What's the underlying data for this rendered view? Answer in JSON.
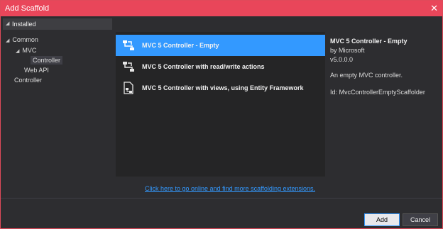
{
  "window": {
    "title": "Add Scaffold",
    "close_icon": "close-icon"
  },
  "tree": {
    "header": "Installed",
    "nodes": [
      {
        "label": "Common",
        "level": 0,
        "expanded": true
      },
      {
        "label": "MVC",
        "level": 1,
        "expanded": true
      },
      {
        "label": "Controller",
        "level": 2,
        "selected": true
      },
      {
        "label": "Web API",
        "level": 1
      },
      {
        "label": "Controller",
        "level": 0
      }
    ]
  },
  "scaffolds": [
    {
      "label": "MVC 5 Controller - Empty",
      "icon": "controller-icon",
      "selected": true
    },
    {
      "label": "MVC 5 Controller with read/write actions",
      "icon": "controller-icon"
    },
    {
      "label": "MVC 5 Controller with views, using Entity Framework",
      "icon": "controller-views-icon"
    }
  ],
  "details": {
    "name": "MVC 5 Controller - Empty",
    "author": "by Microsoft",
    "version": "v5.0.0.0",
    "description": "An empty MVC controller.",
    "id": "Id: MvcControllerEmptyScaffolder"
  },
  "online_link": "Click here to go online and find more scaffolding extensions.",
  "buttons": {
    "add": "Add",
    "cancel": "Cancel"
  },
  "colors": {
    "titlebar": "#e9465a",
    "selection": "#3399ff",
    "background": "#2d2d30"
  }
}
